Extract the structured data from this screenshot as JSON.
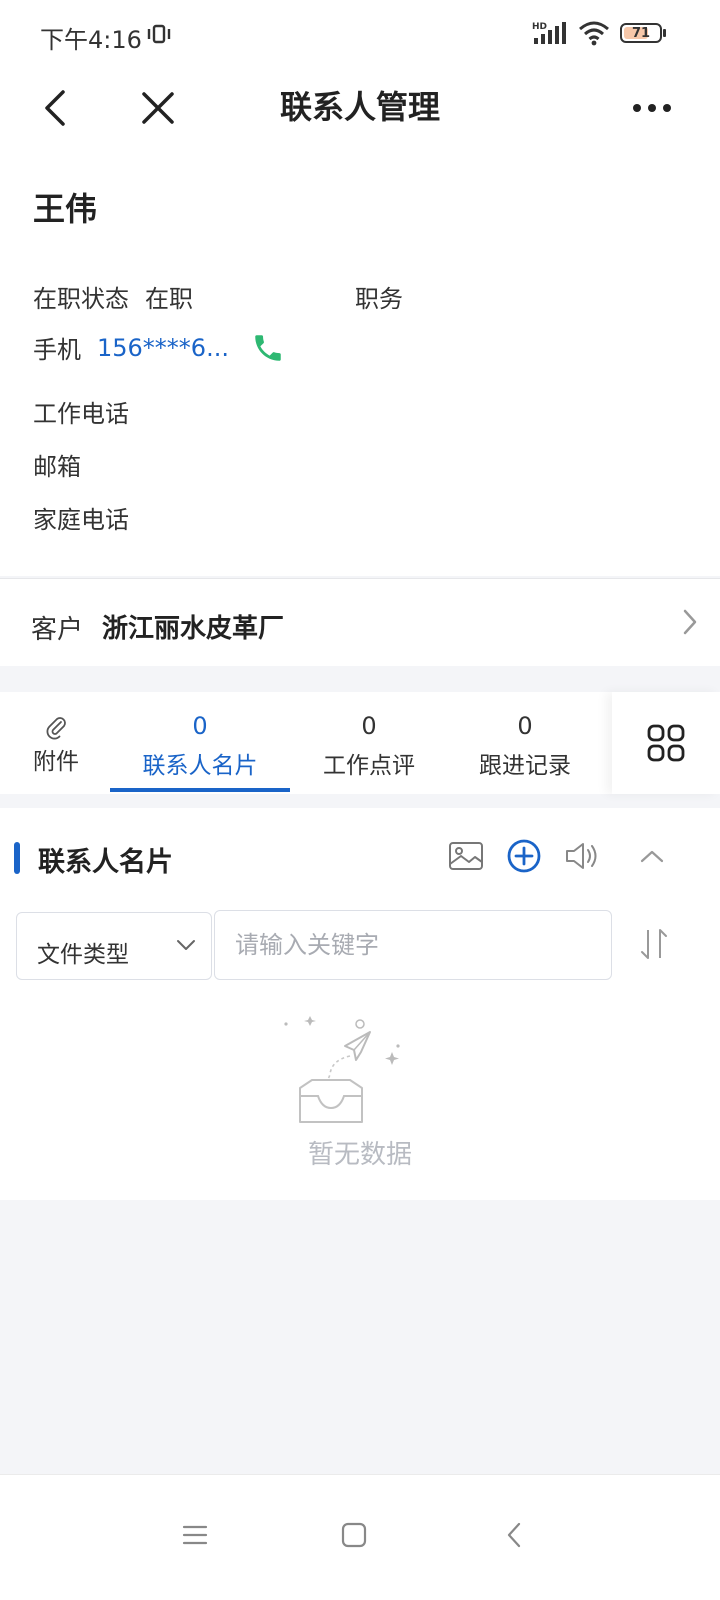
{
  "status_bar": {
    "time": "下午4:16",
    "network": "HD",
    "battery": "71",
    "battery_level": 0.71
  },
  "nav": {
    "title": "联系人管理",
    "icons": [
      "back-icon",
      "close-icon",
      "more-icon"
    ]
  },
  "contact": {
    "name": "王伟",
    "employment_label": "在职状态",
    "employment_value": "在职",
    "job_label": "职务",
    "mobile_label": "手机",
    "mobile_value": "156****6...",
    "work_phone_label": "工作电话",
    "email_label": "邮箱",
    "home_phone_label": "家庭电话"
  },
  "customer": {
    "label": "客户",
    "value": "浙江丽水皮革厂"
  },
  "tabs": [
    {
      "count": "",
      "label": "附件"
    },
    {
      "count": "0",
      "label": "联系人名片"
    },
    {
      "count": "0",
      "label": "工作点评"
    },
    {
      "count": "0",
      "label": "跟进记录"
    }
  ],
  "active_tab": 1,
  "section": {
    "title": "联系人名片",
    "file_type_label": "文件类型",
    "search_placeholder": "请输入关键字",
    "empty_text": "暂无数据"
  },
  "colors": {
    "accent": "#1a64c8",
    "phone_icon": "#2eb872",
    "background": "#f4f5f8"
  }
}
